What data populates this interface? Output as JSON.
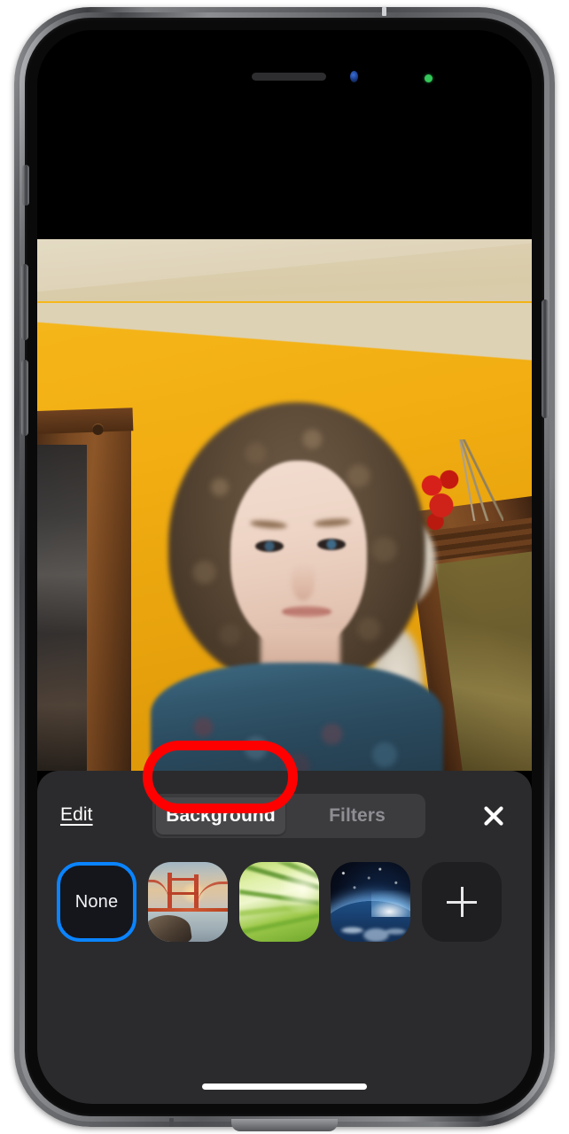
{
  "device": {
    "name": "iPhone",
    "notch": {
      "speaker": "earpiece-speaker",
      "camera": "front-camera",
      "recording_indicator": "green-camera-in-use-dot"
    },
    "home_indicator": "home-indicator-bar"
  },
  "video": {
    "description": "Front camera self-view of a woman with curly brown hair wearing a blue patterned top, in a room with a yellow wall, cream ceiling and wooden cabinets.",
    "wall_color": "#f2ae12",
    "ceiling_color": "#ded2b4",
    "cabinet_color": "#7a4a22"
  },
  "control_panel": {
    "edit_label": "Edit",
    "close_label": "Close",
    "close_icon": "close-x-icon",
    "tabs": [
      {
        "label": "Background",
        "selected": true
      },
      {
        "label": "Filters",
        "selected": false
      }
    ],
    "backgrounds": [
      {
        "label": "None",
        "type": "none",
        "selected": true
      },
      {
        "label": "Golden Gate Bridge",
        "type": "image",
        "selected": false
      },
      {
        "label": "Grass",
        "type": "image",
        "selected": false
      },
      {
        "label": "Earth from Space",
        "type": "image",
        "selected": false
      },
      {
        "label": "Add Background",
        "type": "add",
        "icon": "plus-icon",
        "selected": false
      }
    ]
  },
  "annotation": {
    "shape": "oval",
    "color": "#fe0000",
    "target": "Background",
    "purpose": "highlights the Background tab"
  },
  "colors": {
    "accent_blue": "#0a84ff",
    "annotation_red": "#fe0000",
    "panel_background": "#2b2b2d",
    "segment_track": "#3c3c3e",
    "segment_active": "#48484a",
    "inactive_text": "#8e8e93",
    "green_indicator": "#34c759"
  }
}
